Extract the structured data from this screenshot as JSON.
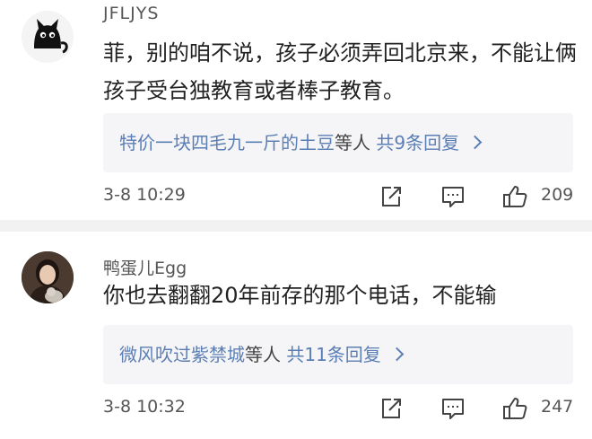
{
  "comments": [
    {
      "username": "JFLJYS",
      "content": "菲，别的咱不说，孩子必须弄回北京来，不能让俩孩子受台独教育或者棒子教育。",
      "replies": {
        "names": "特价一块四毛九一斤的土豆",
        "middle": "等人",
        "count": "共9条回复"
      },
      "time": "3-8 10:29",
      "likes": "209",
      "avatar_icon": "black-cat-avatar"
    },
    {
      "username": "鸭蛋儿Egg",
      "content": "你也去翻翻20年前存的那个电话，不能输",
      "replies": {
        "names": "微风吹过紫禁城",
        "middle": "等人",
        "count": "共11条回复"
      },
      "time": "3-8 10:32",
      "likes": "247",
      "avatar_icon": "person-with-cat-avatar"
    }
  ],
  "colors": {
    "link": "#5b7fb5",
    "text": "#222222",
    "meta": "#555555",
    "reply_bg": "#f5f5f7",
    "separator": "#f2f2f2"
  }
}
